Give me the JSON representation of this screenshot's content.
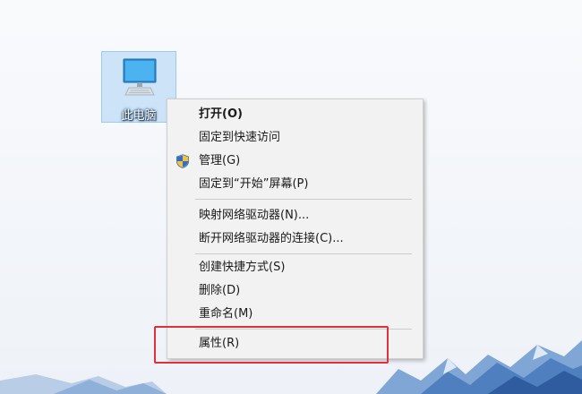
{
  "desktop": {
    "icon_label": "此电脑",
    "icon_name": "computer-icon"
  },
  "context_menu": {
    "items": [
      {
        "label": "打开(O)"
      },
      {
        "label": "固定到快速访问"
      },
      {
        "label": "管理(G)",
        "icon": "uac-shield-icon"
      },
      {
        "label": "固定到“开始”屏幕(P)"
      },
      {
        "label": "映射网络驱动器(N)..."
      },
      {
        "label": "断开网络驱动器的连接(C)..."
      },
      {
        "label": "创建快捷方式(S)"
      },
      {
        "label": "删除(D)"
      },
      {
        "label": "重命名(M)"
      },
      {
        "label": "属性(R)"
      }
    ]
  },
  "annotation": {
    "highlight_color": "#e0303a"
  }
}
